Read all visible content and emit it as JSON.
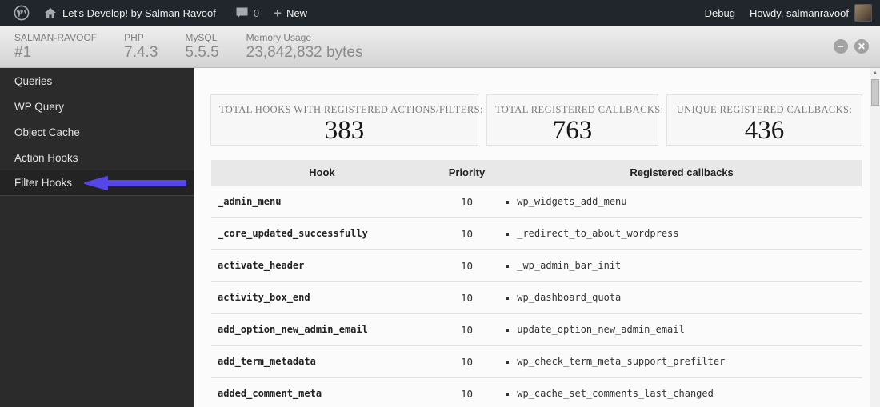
{
  "admin_bar": {
    "site_name": "Let's Develop! by Salman Ravoof",
    "comment_count": "0",
    "new_label": "New",
    "debug_label": "Debug",
    "howdy": "Howdy, salmanravoof"
  },
  "debug_header": {
    "items": [
      {
        "label": "SALMAN-RAVOOF",
        "value": "#1"
      },
      {
        "label": "PHP",
        "value": "7.4.3"
      },
      {
        "label": "MySQL",
        "value": "5.5.5"
      },
      {
        "label": "Memory Usage",
        "value": "23,842,832 bytes"
      }
    ],
    "minimize_glyph": "−",
    "close_glyph": "✕"
  },
  "sidebar": {
    "items": [
      {
        "label": "Queries",
        "active": false
      },
      {
        "label": "WP Query",
        "active": false
      },
      {
        "label": "Object Cache",
        "active": false
      },
      {
        "label": "Action Hooks",
        "active": false
      },
      {
        "label": "Filter Hooks",
        "active": true
      }
    ],
    "arrow_color": "#5646e5"
  },
  "main": {
    "stats": [
      {
        "label": "TOTAL HOOKS WITH REGISTERED ACTIONS/FILTERS:",
        "value": "383"
      },
      {
        "label": "TOTAL REGISTERED CALLBACKS:",
        "value": "763"
      },
      {
        "label": "UNIQUE REGISTERED CALLBACKS:",
        "value": "436"
      }
    ],
    "table": {
      "headers": [
        "Hook",
        "Priority",
        "Registered callbacks"
      ],
      "rows": [
        {
          "hook": "_admin_menu",
          "priority": "10",
          "callbacks": [
            "wp_widgets_add_menu"
          ]
        },
        {
          "hook": "_core_updated_successfully",
          "priority": "10",
          "callbacks": [
            "_redirect_to_about_wordpress"
          ]
        },
        {
          "hook": "activate_header",
          "priority": "10",
          "callbacks": [
            "_wp_admin_bar_init"
          ]
        },
        {
          "hook": "activity_box_end",
          "priority": "10",
          "callbacks": [
            "wp_dashboard_quota"
          ]
        },
        {
          "hook": "add_option_new_admin_email",
          "priority": "10",
          "callbacks": [
            "update_option_new_admin_email"
          ]
        },
        {
          "hook": "add_term_metadata",
          "priority": "10",
          "callbacks": [
            "wp_check_term_meta_support_prefilter"
          ]
        },
        {
          "hook": "added_comment_meta",
          "priority": "10",
          "callbacks": [
            "wp_cache_set_comments_last_changed"
          ]
        }
      ]
    }
  },
  "colors": {
    "admin_bar_bg": "#20262b",
    "debug_header_bg": "#dedede",
    "sidebar_bg": "#2b2b2b",
    "arrow_accent": "#5646e5",
    "stat_box_bg": "#f7f7f7",
    "table_header_bg": "#e8e8e8"
  }
}
